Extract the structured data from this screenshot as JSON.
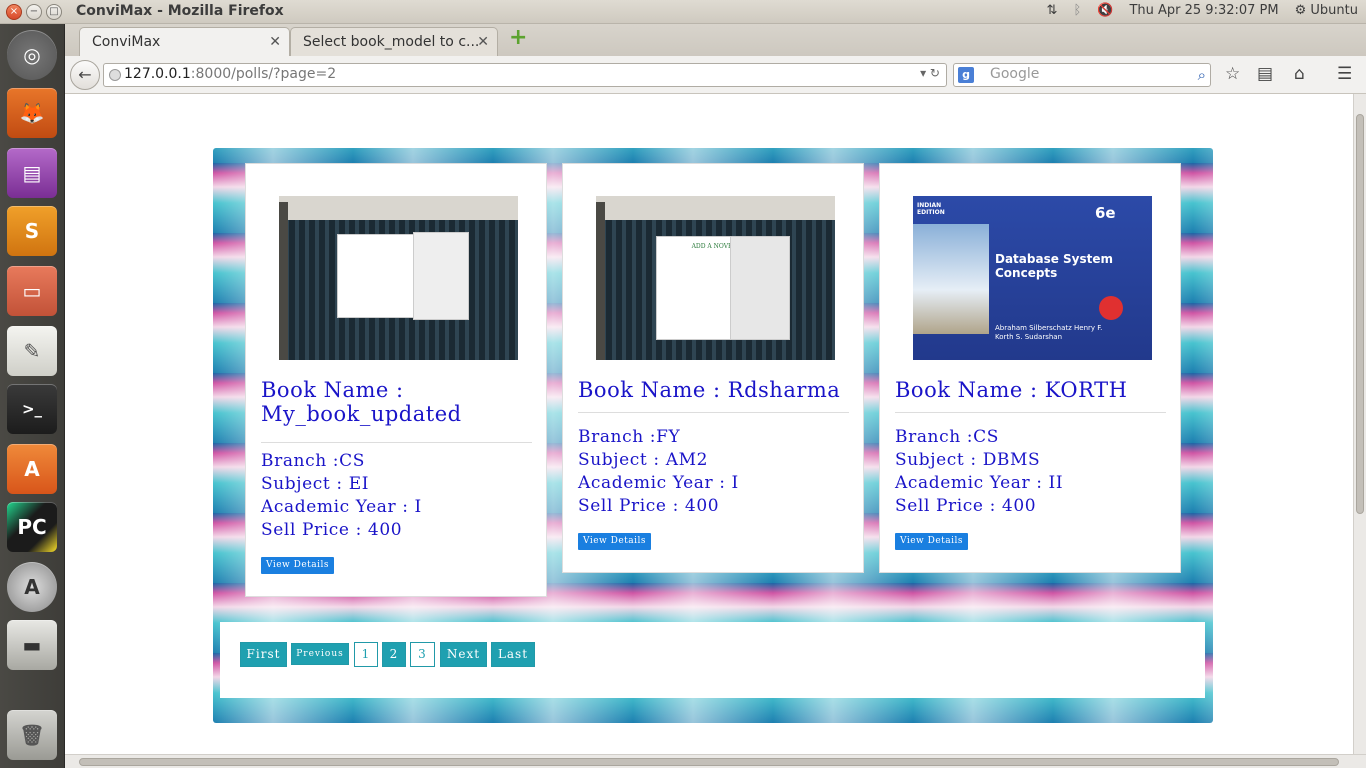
{
  "window": {
    "title": "ConviMax - Mozilla Firefox",
    "datetime": "Thu Apr 25  9:32:07 PM",
    "user": "Ubuntu"
  },
  "tabs": [
    {
      "label": "ConviMax"
    },
    {
      "label": "Select book_model to c..."
    }
  ],
  "nav": {
    "url_host": "127.0.0.1",
    "url_path": ":8000/polls/?page=2",
    "search_placeholder": "Google"
  },
  "books": [
    {
      "title": "Book Name : My_book_updated",
      "branch": "Branch :CS",
      "subject": "Subject : EI",
      "year": "Academic Year : I",
      "price": "Sell Price : 400",
      "button": "View Details"
    },
    {
      "title": "Book Name : Rdsharma",
      "branch": "Branch :FY",
      "subject": "Subject : AM2",
      "year": "Academic Year : I",
      "price": "Sell Price : 400",
      "button": "View Details"
    },
    {
      "title": "Book Name : KORTH",
      "branch": "Branch :CS",
      "subject": "Subject : DBMS",
      "year": "Academic Year : II",
      "price": "Sell Price : 400",
      "button": "View Details"
    }
  ],
  "book_cover": {
    "edition_badge": "INDIAN EDITION",
    "edition": "6e",
    "title": "Database System Concepts",
    "authors": "Abraham Silberschatz Henry F. Korth S. Sudarshan"
  },
  "thumb2_heading": "ADD A NOVEL",
  "pagination": {
    "first": "First",
    "previous": "Previous",
    "pages": [
      "1",
      "2",
      "3"
    ],
    "next": "Next",
    "last": "Last"
  }
}
